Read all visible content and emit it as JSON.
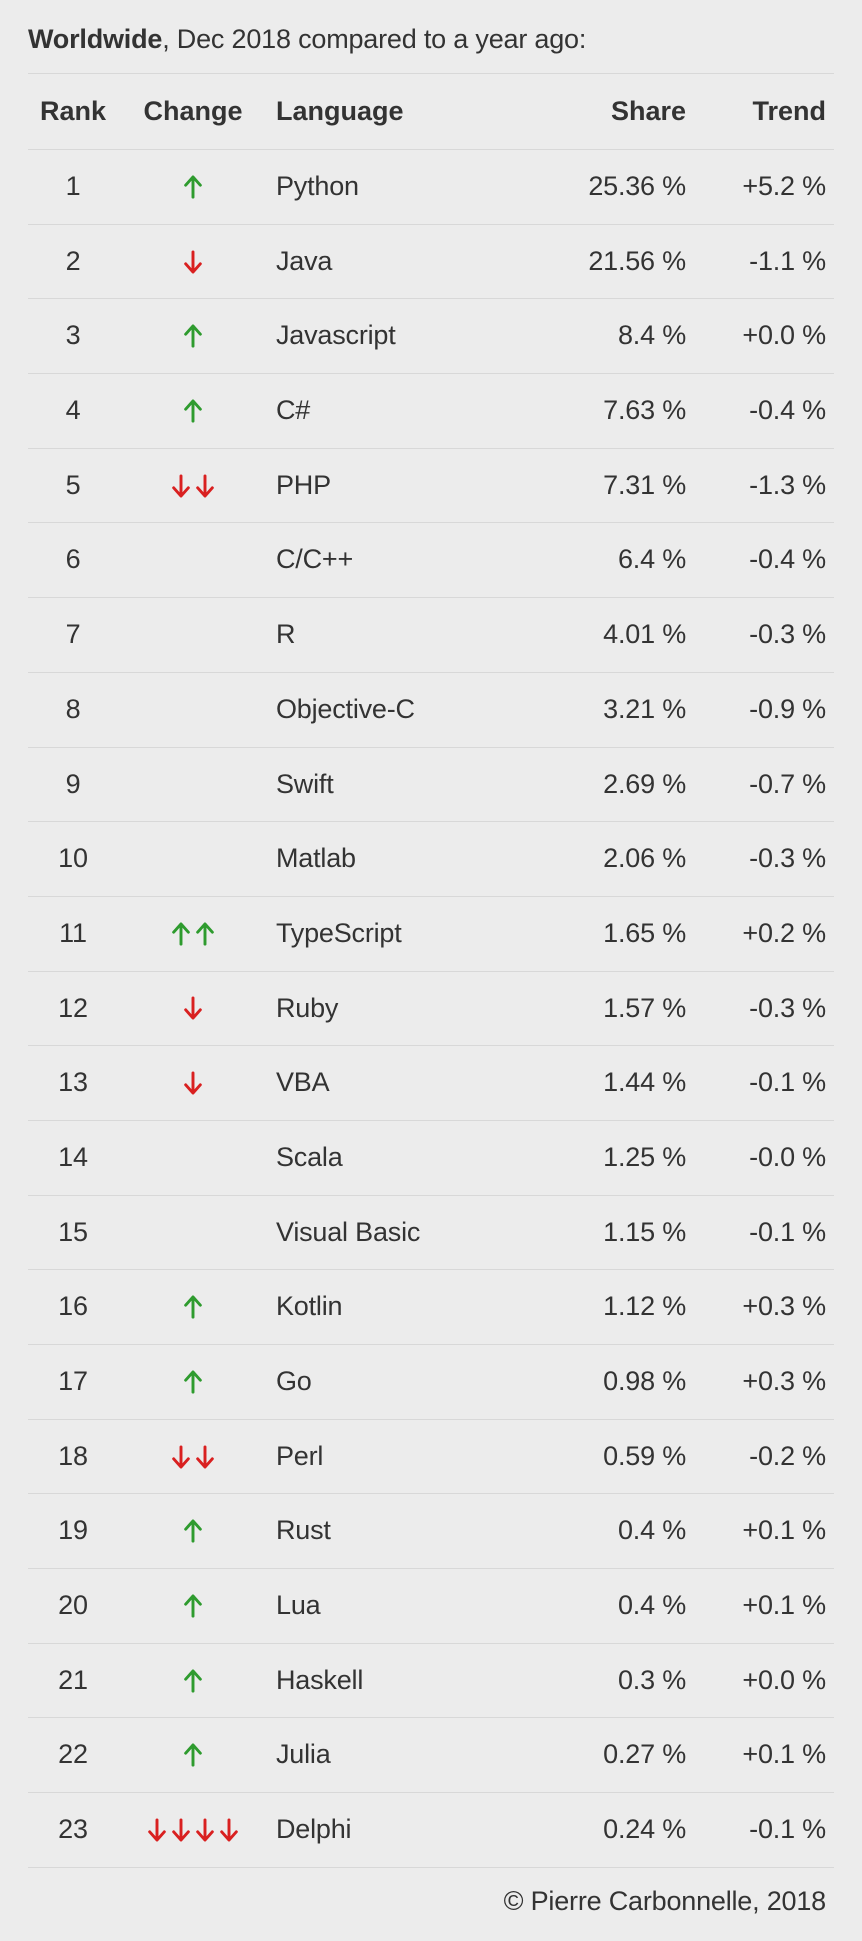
{
  "caption": {
    "bold": "Worldwide",
    "rest": ", Dec 2018 compared to a year ago:"
  },
  "columns": {
    "rank": "Rank",
    "change": "Change",
    "language": "Language",
    "share": "Share",
    "trend": "Trend"
  },
  "rows": [
    {
      "rank": "1",
      "change_dir": "up",
      "change_count": 1,
      "language": "Python",
      "share": "25.36 %",
      "trend": "+5.2 %"
    },
    {
      "rank": "2",
      "change_dir": "down",
      "change_count": 1,
      "language": "Java",
      "share": "21.56 %",
      "trend": "-1.1 %"
    },
    {
      "rank": "3",
      "change_dir": "up",
      "change_count": 1,
      "language": "Javascript",
      "share": "8.4 %",
      "trend": "+0.0 %"
    },
    {
      "rank": "4",
      "change_dir": "up",
      "change_count": 1,
      "language": "C#",
      "share": "7.63 %",
      "trend": "-0.4 %"
    },
    {
      "rank": "5",
      "change_dir": "down",
      "change_count": 2,
      "language": "PHP",
      "share": "7.31 %",
      "trend": "-1.3 %"
    },
    {
      "rank": "6",
      "change_dir": "none",
      "change_count": 0,
      "language": "C/C++",
      "share": "6.4 %",
      "trend": "-0.4 %"
    },
    {
      "rank": "7",
      "change_dir": "none",
      "change_count": 0,
      "language": "R",
      "share": "4.01 %",
      "trend": "-0.3 %"
    },
    {
      "rank": "8",
      "change_dir": "none",
      "change_count": 0,
      "language": "Objective-C",
      "share": "3.21 %",
      "trend": "-0.9 %"
    },
    {
      "rank": "9",
      "change_dir": "none",
      "change_count": 0,
      "language": "Swift",
      "share": "2.69 %",
      "trend": "-0.7 %"
    },
    {
      "rank": "10",
      "change_dir": "none",
      "change_count": 0,
      "language": "Matlab",
      "share": "2.06 %",
      "trend": "-0.3 %"
    },
    {
      "rank": "11",
      "change_dir": "up",
      "change_count": 2,
      "language": "TypeScript",
      "share": "1.65 %",
      "trend": "+0.2 %"
    },
    {
      "rank": "12",
      "change_dir": "down",
      "change_count": 1,
      "language": "Ruby",
      "share": "1.57 %",
      "trend": "-0.3 %"
    },
    {
      "rank": "13",
      "change_dir": "down",
      "change_count": 1,
      "language": "VBA",
      "share": "1.44 %",
      "trend": "-0.1 %"
    },
    {
      "rank": "14",
      "change_dir": "none",
      "change_count": 0,
      "language": "Scala",
      "share": "1.25 %",
      "trend": "-0.0 %"
    },
    {
      "rank": "15",
      "change_dir": "none",
      "change_count": 0,
      "language": "Visual Basic",
      "share": "1.15 %",
      "trend": "-0.1 %"
    },
    {
      "rank": "16",
      "change_dir": "up",
      "change_count": 1,
      "language": "Kotlin",
      "share": "1.12 %",
      "trend": "+0.3 %"
    },
    {
      "rank": "17",
      "change_dir": "up",
      "change_count": 1,
      "language": "Go",
      "share": "0.98 %",
      "trend": "+0.3 %"
    },
    {
      "rank": "18",
      "change_dir": "down",
      "change_count": 2,
      "language": "Perl",
      "share": "0.59 %",
      "trend": "-0.2 %"
    },
    {
      "rank": "19",
      "change_dir": "up",
      "change_count": 1,
      "language": "Rust",
      "share": "0.4 %",
      "trend": "+0.1 %"
    },
    {
      "rank": "20",
      "change_dir": "up",
      "change_count": 1,
      "language": "Lua",
      "share": "0.4 %",
      "trend": "+0.1 %"
    },
    {
      "rank": "21",
      "change_dir": "up",
      "change_count": 1,
      "language": "Haskell",
      "share": "0.3 %",
      "trend": "+0.0 %"
    },
    {
      "rank": "22",
      "change_dir": "up",
      "change_count": 1,
      "language": "Julia",
      "share": "0.27 %",
      "trend": "+0.1 %"
    },
    {
      "rank": "23",
      "change_dir": "down",
      "change_count": 4,
      "language": "Delphi",
      "share": "0.24 %",
      "trend": "-0.1 %"
    }
  ],
  "footer": "© Pierre Carbonnelle, 2018",
  "chart_data": {
    "type": "table",
    "title": "Worldwide, Dec 2018 compared to a year ago",
    "columns": [
      "Rank",
      "Change",
      "Language",
      "Share (%)",
      "Trend (%)"
    ],
    "data": [
      [
        1,
        "+1",
        "Python",
        25.36,
        5.2
      ],
      [
        2,
        "-1",
        "Java",
        21.56,
        -1.1
      ],
      [
        3,
        "+1",
        "Javascript",
        8.4,
        0.0
      ],
      [
        4,
        "+1",
        "C#",
        7.63,
        -0.4
      ],
      [
        5,
        "-2",
        "PHP",
        7.31,
        -1.3
      ],
      [
        6,
        "0",
        "C/C++",
        6.4,
        -0.4
      ],
      [
        7,
        "0",
        "R",
        4.01,
        -0.3
      ],
      [
        8,
        "0",
        "Objective-C",
        3.21,
        -0.9
      ],
      [
        9,
        "0",
        "Swift",
        2.69,
        -0.7
      ],
      [
        10,
        "0",
        "Matlab",
        2.06,
        -0.3
      ],
      [
        11,
        "+2",
        "TypeScript",
        1.65,
        0.2
      ],
      [
        12,
        "-1",
        "Ruby",
        1.57,
        -0.3
      ],
      [
        13,
        "-1",
        "VBA",
        1.44,
        -0.1
      ],
      [
        14,
        "0",
        "Scala",
        1.25,
        0.0
      ],
      [
        15,
        "0",
        "Visual Basic",
        1.15,
        -0.1
      ],
      [
        16,
        "+1",
        "Kotlin",
        1.12,
        0.3
      ],
      [
        17,
        "+1",
        "Go",
        0.98,
        0.3
      ],
      [
        18,
        "-2",
        "Perl",
        0.59,
        -0.2
      ],
      [
        19,
        "+1",
        "Rust",
        0.4,
        0.1
      ],
      [
        20,
        "+1",
        "Lua",
        0.4,
        0.1
      ],
      [
        21,
        "+1",
        "Haskell",
        0.3,
        0.0
      ],
      [
        22,
        "+1",
        "Julia",
        0.27,
        0.1
      ],
      [
        23,
        "-4",
        "Delphi",
        0.24,
        -0.1
      ]
    ]
  }
}
